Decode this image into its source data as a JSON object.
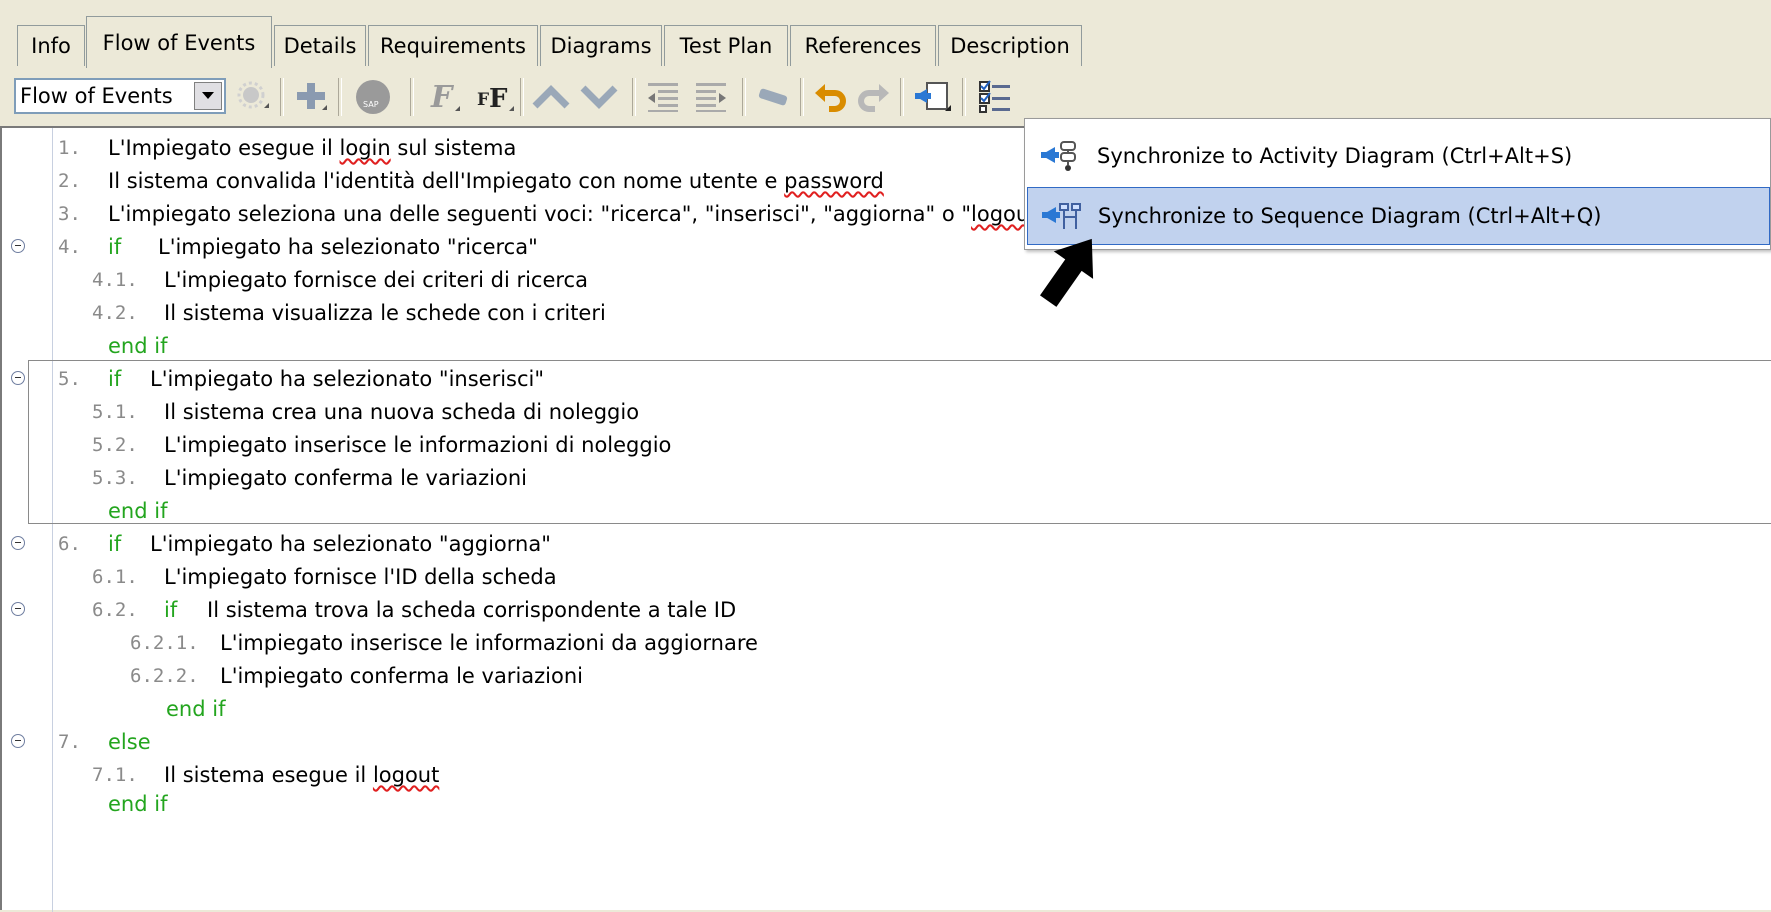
{
  "tabs": [
    {
      "label": "Info",
      "active": false
    },
    {
      "label": "Flow of Events",
      "active": true
    },
    {
      "label": "Details",
      "active": false
    },
    {
      "label": "Requirements",
      "active": false
    },
    {
      "label": "Diagrams",
      "active": false
    },
    {
      "label": "Test Plan",
      "active": false
    },
    {
      "label": "References",
      "active": false
    },
    {
      "label": "Description",
      "active": false
    }
  ],
  "toolbar": {
    "combo_value": "Flow of Events",
    "icons": [
      "extension-point-icon",
      "add-step-icon",
      "sap-icon",
      "italic-f-icon",
      "format-fe-icon",
      "move-up-icon",
      "move-down-icon",
      "outdent-icon",
      "indent-icon",
      "link-icon",
      "undo-icon",
      "redo-icon",
      "synchronize-icon",
      "checklist-icon"
    ]
  },
  "flow": {
    "lines": [
      {
        "num": "1.",
        "keyword": "",
        "text": "L'Impiegato esegue il ",
        "spell": "login",
        "after": " sul sistema"
      },
      {
        "num": "2.",
        "keyword": "",
        "text": "Il sistema convalida l'identità dell'Impiegato con nome utente e ",
        "spell": "password",
        "after": ""
      },
      {
        "num": "3.",
        "keyword": "",
        "text": "L'impiegato seleziona una delle seguenti voci:  \"ricerca\", \"inserisci\", \"aggiorna\" o \"",
        "spell": "logout",
        "after": "\""
      },
      {
        "num": "4.",
        "keyword": "if",
        "text": "L'impiegato ha selezionato \"ricerca\"",
        "spell": "",
        "after": ""
      },
      {
        "num": "4.1.",
        "keyword": "",
        "text": "L'impiegato fornisce dei criteri di ricerca",
        "spell": "",
        "after": ""
      },
      {
        "num": "4.2.",
        "keyword": "",
        "text": "Il sistema visualizza le schede con i criteri",
        "spell": "",
        "after": ""
      },
      {
        "num": "",
        "keyword": "end if",
        "text": "",
        "spell": "",
        "after": ""
      },
      {
        "num": "5.",
        "keyword": "if",
        "text": "L'impiegato ha selezionato \"inserisci\"",
        "spell": "",
        "after": ""
      },
      {
        "num": "5.1.",
        "keyword": "",
        "text": "Il sistema crea una nuova scheda di noleggio",
        "spell": "",
        "after": ""
      },
      {
        "num": "5.2.",
        "keyword": "",
        "text": "L'impiegato inserisce le informazioni di noleggio",
        "spell": "",
        "after": ""
      },
      {
        "num": "5.3.",
        "keyword": "",
        "text": "L'impiegato conferma le variazioni",
        "spell": "",
        "after": ""
      },
      {
        "num": "",
        "keyword": "end if",
        "text": "",
        "spell": "",
        "after": ""
      },
      {
        "num": "6.",
        "keyword": "if",
        "text": "L'impiegato ha selezionato \"aggiorna\"",
        "spell": "",
        "after": ""
      },
      {
        "num": "6.1.",
        "keyword": "",
        "text": "L'impiegato fornisce l'ID della scheda",
        "spell": "",
        "after": ""
      },
      {
        "num": "6.2.",
        "keyword": "if",
        "text": "Il sistema trova la scheda corrispondente a tale ID",
        "spell": "",
        "after": ""
      },
      {
        "num": "6.2.1.",
        "keyword": "",
        "text": "L'impiegato inserisce le informazioni da aggiornare",
        "spell": "",
        "after": ""
      },
      {
        "num": "6.2.2.",
        "keyword": "",
        "text": "L'impiegato conferma le variazioni",
        "spell": "",
        "after": ""
      },
      {
        "num": "",
        "keyword": "end if",
        "text": "",
        "spell": "",
        "after": ""
      },
      {
        "num": "7.",
        "keyword": "else",
        "text": "",
        "spell": "",
        "after": ""
      },
      {
        "num": "7.1.",
        "keyword": "",
        "text": "Il sistema esegue il ",
        "spell": "logout",
        "after": ""
      },
      {
        "num": "",
        "keyword": "end if",
        "text": "",
        "spell": "",
        "after": ""
      }
    ]
  },
  "popup_menu": {
    "items": [
      {
        "label": "Synchronize to Activity Diagram (Ctrl+Alt+S)",
        "icon": "activity-diagram-icon"
      },
      {
        "label": "Synchronize to Sequence Diagram (Ctrl+Alt+Q)",
        "icon": "sequence-diagram-icon"
      }
    ]
  },
  "colors": {
    "keyword": "#23a51e",
    "line_number": "#8a8a8a",
    "menu_highlight": "#c1d2ee",
    "chrome": "#ece9d8"
  }
}
